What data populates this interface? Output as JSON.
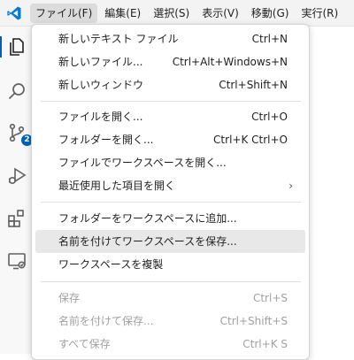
{
  "menubar": {
    "items": [
      {
        "label": "ファイル(F)"
      },
      {
        "label": "編集(E)"
      },
      {
        "label": "選択(S)"
      },
      {
        "label": "表示(V)"
      },
      {
        "label": "移動(G)"
      },
      {
        "label": "実行(R)"
      }
    ]
  },
  "activitybar": {
    "source_control_badge": "2"
  },
  "file_menu": {
    "groups": [
      [
        {
          "label": "新しいテキスト ファイル",
          "shortcut": "Ctrl+N"
        },
        {
          "label": "新しいファイル...",
          "shortcut": "Ctrl+Alt+Windows+N"
        },
        {
          "label": "新しいウィンドウ",
          "shortcut": "Ctrl+Shift+N"
        }
      ],
      [
        {
          "label": "ファイルを開く...",
          "shortcut": "Ctrl+O"
        },
        {
          "label": "フォルダーを開く...",
          "shortcut": "Ctrl+K Ctrl+O"
        },
        {
          "label": "ファイルでワークスペースを開く...",
          "shortcut": ""
        },
        {
          "label": "最近使用した項目を開く",
          "shortcut": ""
        }
      ],
      [
        {
          "label": "フォルダーをワークスペースに追加...",
          "shortcut": ""
        },
        {
          "label": "名前を付けてワークスペースを保存...",
          "shortcut": ""
        },
        {
          "label": "ワークスペースを複製",
          "shortcut": ""
        }
      ],
      [
        {
          "label": "保存",
          "shortcut": "Ctrl+S"
        },
        {
          "label": "名前を付けて保存...",
          "shortcut": "Ctrl+Shift+S"
        },
        {
          "label": "すべて保存",
          "shortcut": "Ctrl+K S"
        }
      ]
    ]
  },
  "colors": {
    "accent": "#005fb8",
    "logo": "#0078d4"
  }
}
